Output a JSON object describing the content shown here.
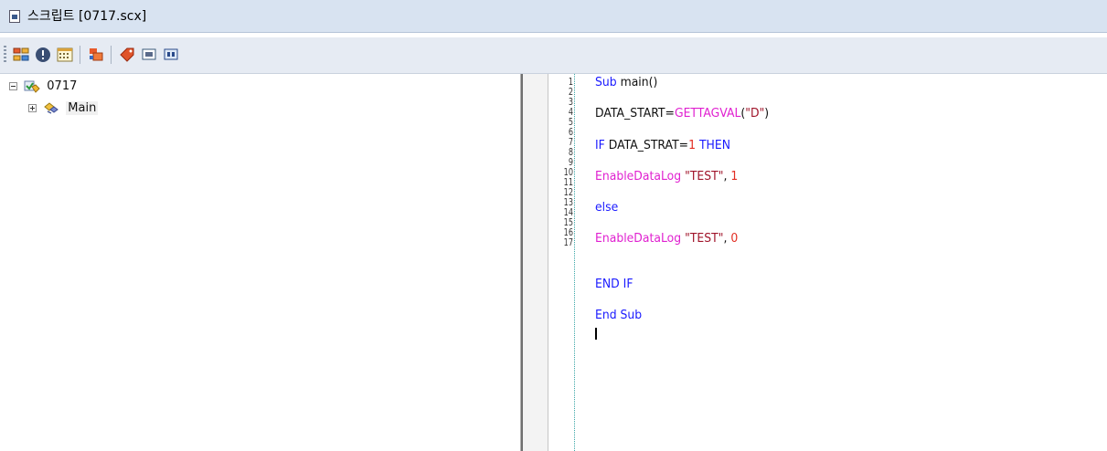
{
  "window": {
    "title": "스크립트 [0717.scx]"
  },
  "toolbar": {
    "buttons": [
      {
        "name": "tree-view-button",
        "icon": "tree-view-icon"
      },
      {
        "name": "info-button",
        "icon": "info-icon"
      },
      {
        "name": "calendar-button",
        "icon": "calendar-icon"
      },
      {
        "name": "tag-export-button",
        "icon": "tag-export-icon"
      },
      {
        "name": "tag-button",
        "icon": "tag-icon"
      },
      {
        "name": "screen-button",
        "icon": "screen-icon"
      },
      {
        "name": "screen-text-button",
        "icon": "screen-text-icon"
      }
    ]
  },
  "tree": {
    "root": {
      "label": "0717",
      "expanded": true
    },
    "children": [
      {
        "label": "Main",
        "expanded": false
      }
    ]
  },
  "editor": {
    "line_numbers": [
      "1",
      "2",
      "3",
      "4",
      "5",
      "6",
      "7",
      "8",
      "9",
      "10",
      "11",
      "12",
      "13",
      "14",
      "15",
      "16",
      "17"
    ],
    "code": {
      "l1_kw": "Sub",
      "l1_rest": " main()",
      "l3_a": "DATA_START=",
      "l3_fn": "GETTAGVAL",
      "l3_b": "(",
      "l3_str": "\"D\"",
      "l3_c": ")",
      "l5_if": "IF",
      "l5_mid": " DATA_STRAT=",
      "l5_num": "1",
      "l5_then": " THEN",
      "l7_fn": "EnableDataLog",
      "l7_sp": " ",
      "l7_str": "\"TEST\"",
      "l7_comma": ", ",
      "l7_num": "1",
      "l9_kw": "else",
      "l11_fn": "EnableDataLog",
      "l11_sp": " ",
      "l11_str": "\"TEST\"",
      "l11_comma": ", ",
      "l11_num": "0",
      "l14_kw": "END IF",
      "l16_kw": "End Sub"
    }
  },
  "colors": {
    "keyword": "#1a1aff",
    "function": "#e020d0",
    "string": "#a0142a",
    "number": "#e22d22",
    "gutter": "#3aa6a6"
  }
}
